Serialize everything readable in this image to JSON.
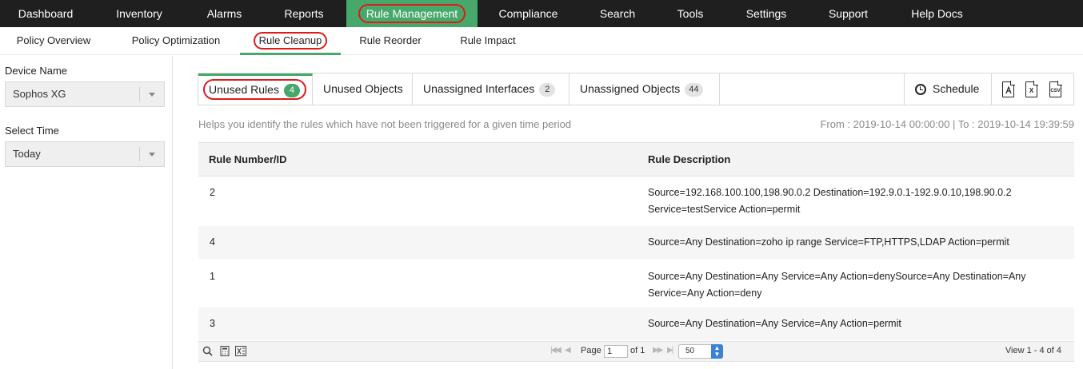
{
  "topnav": {
    "items": [
      "Dashboard",
      "Inventory",
      "Alarms",
      "Reports",
      "Rule Management",
      "Compliance",
      "Search",
      "Tools",
      "Settings",
      "Support",
      "Help Docs"
    ],
    "active": "Rule Management",
    "accent": "#46a86a"
  },
  "subnav": {
    "items": [
      "Policy Overview",
      "Policy Optimization",
      "Rule Cleanup",
      "Rule Reorder",
      "Rule Impact"
    ],
    "active": "Rule Cleanup"
  },
  "sidebar": {
    "device_label": "Device Name",
    "device_value": "Sophos XG",
    "time_label": "Select Time",
    "time_value": "Today"
  },
  "tabs": [
    {
      "label": "Unused Rules",
      "count": "4"
    },
    {
      "label": "Unused Objects",
      "count": ""
    },
    {
      "label": "Unassigned Interfaces",
      "count": "2"
    },
    {
      "label": "Unassigned Objects",
      "count": "44"
    }
  ],
  "toolbar": {
    "schedule_label": "Schedule",
    "export_icons": [
      "pdf-icon",
      "xls-icon",
      "csv-icon"
    ],
    "xls_glyph": "X",
    "csv_glyph": "CSV"
  },
  "help_text": "Helps you identify the rules which have not been triggered for a given time period",
  "date_range": "From : 2019-10-14 00:00:00 | To : 2019-10-14 19:39:59",
  "table": {
    "headers": [
      "Rule Number/ID",
      "Rule Description"
    ],
    "rows": [
      {
        "id": "2",
        "desc_line1": "Source=192.168.100.100,198.90.0.2 Destination=192.9.0.1-192.9.0.10,198.90.0.2",
        "desc_line2": "Service=testService Action=permit"
      },
      {
        "id": "4",
        "desc_line1": "Source=Any Destination=zoho ip range Service=FTP,HTTPS,LDAP Action=permit",
        "desc_line2": ""
      },
      {
        "id": "1",
        "desc_line1": "Source=Any Destination=Any Service=Any Action=denySource=Any Destination=Any",
        "desc_line2": "Service=Any Action=deny"
      },
      {
        "id": "3",
        "desc_line1": "Source=Any Destination=Any Service=Any Action=permit",
        "desc_line2": ""
      }
    ]
  },
  "footer": {
    "page_label": "Page",
    "page_value": "1",
    "of_label": "of 1",
    "page_size": "50",
    "view_text": "View 1 - 4 of 4"
  }
}
